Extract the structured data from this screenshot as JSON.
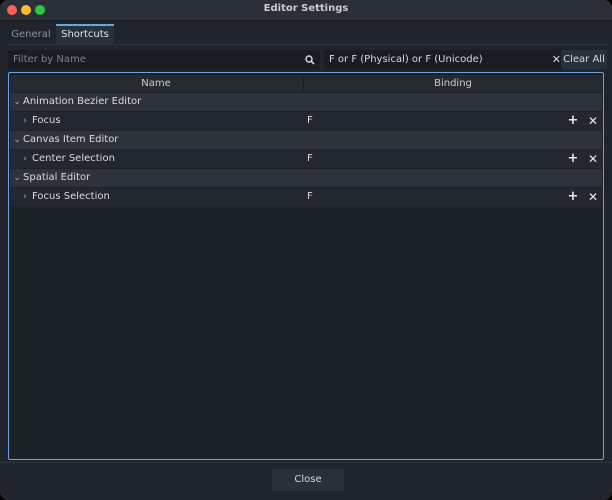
{
  "window": {
    "title": "Editor Settings"
  },
  "tabs": [
    {
      "label": "General",
      "active": false
    },
    {
      "label": "Shortcuts",
      "active": true
    }
  ],
  "search": {
    "filter_placeholder": "Filter by Name",
    "binding_value": "F or F (Physical) or F (Unicode)",
    "clear_all_label": "Clear All"
  },
  "table": {
    "columns": [
      "Name",
      "Binding"
    ],
    "sections": [
      {
        "label": "Animation Bezier Editor",
        "items": [
          {
            "name": "Focus",
            "binding": "F"
          }
        ]
      },
      {
        "label": "Canvas Item Editor",
        "items": [
          {
            "name": "Center Selection",
            "binding": "F"
          }
        ]
      },
      {
        "label": "Spatial Editor",
        "items": [
          {
            "name": "Focus Selection",
            "binding": "F"
          }
        ]
      }
    ]
  },
  "footer": {
    "close_label": "Close"
  },
  "colors": {
    "accent": "#6aa5e0",
    "background": "#20252d",
    "close_light": "#ff5f57",
    "minimize_light": "#febc2e",
    "zoom_light": "#28c840"
  },
  "icons": {
    "search": "search-icon",
    "clear": "close-icon",
    "expand": "chevron-down-icon",
    "collapse": "chevron-right-icon",
    "add": "plus-icon",
    "remove": "close-icon"
  }
}
